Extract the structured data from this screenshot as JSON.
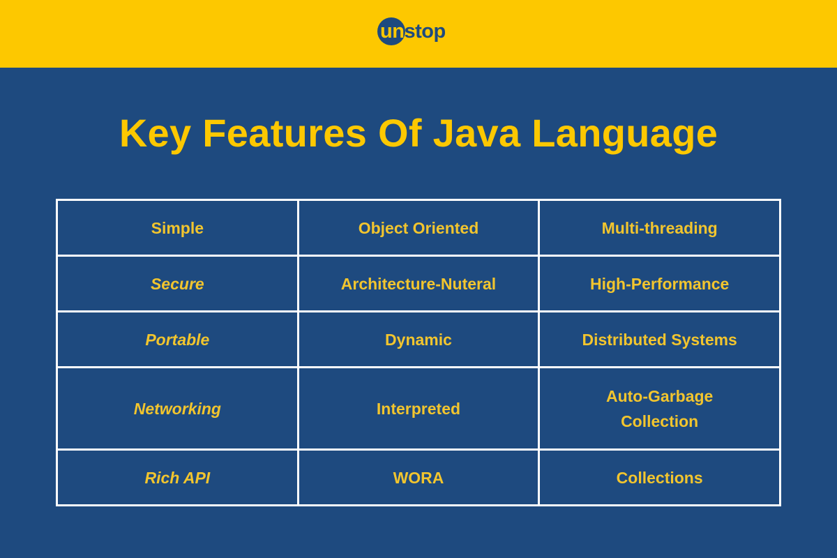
{
  "brand": {
    "logo_prefix": "un",
    "logo_suffix": "stop",
    "colors": {
      "primary_yellow": "#fdc800",
      "primary_blue": "#1e4a7f",
      "text_yellow": "#f2c52e",
      "grid_lines": "#ffffff"
    }
  },
  "title": "Key Features Of Java Language",
  "table": {
    "rows": [
      [
        {
          "text": "Simple",
          "italic": false
        },
        {
          "text": "Object Oriented",
          "italic": false
        },
        {
          "text": "Multi-threading",
          "italic": false
        }
      ],
      [
        {
          "text": "Secure",
          "italic": true
        },
        {
          "text": "Architecture-Nuteral",
          "italic": false
        },
        {
          "text": "High-Performance",
          "italic": false
        }
      ],
      [
        {
          "text": "Portable",
          "italic": true
        },
        {
          "text": "Dynamic",
          "italic": false
        },
        {
          "text": "Distributed Systems",
          "italic": false
        }
      ],
      [
        {
          "text": "Networking",
          "italic": true
        },
        {
          "text": "Interpreted",
          "italic": false
        },
        {
          "text": "Auto-Garbage Collection",
          "italic": false
        }
      ],
      [
        {
          "text": "Rich API",
          "italic": true
        },
        {
          "text": "WORA",
          "italic": false
        },
        {
          "text": "Collections",
          "italic": false
        }
      ]
    ]
  }
}
